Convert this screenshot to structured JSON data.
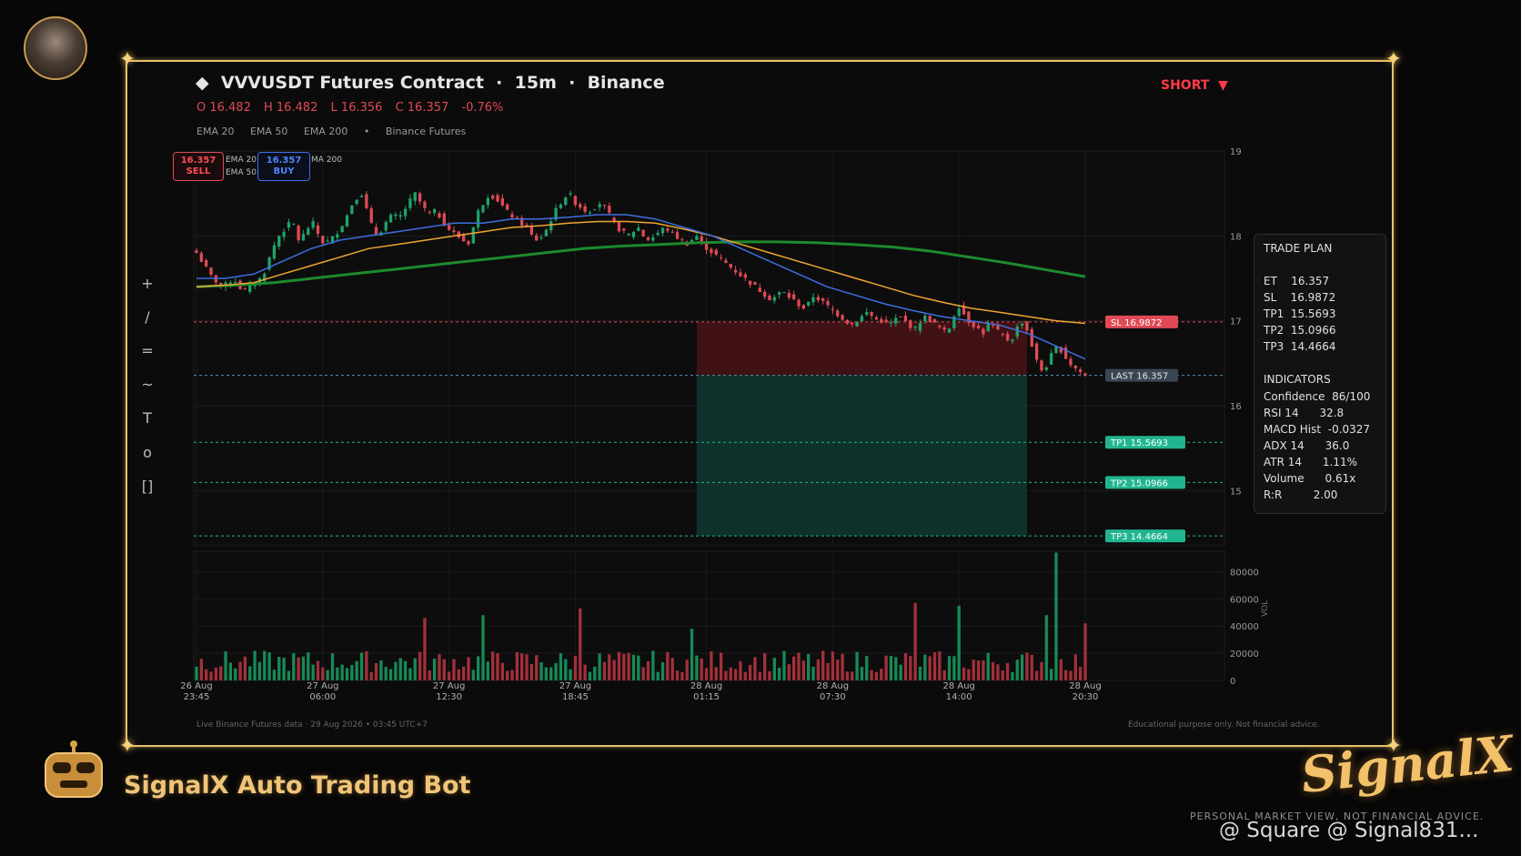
{
  "header": {
    "title": "VVVUSDT Futures Contract",
    "timeframe": "15m",
    "exchange": "Binance",
    "ohlc": {
      "open": "O 16.482",
      "high": "H 16.482",
      "low": "L 16.356",
      "close": "C 16.357",
      "change": "-0.76%"
    },
    "indicators": [
      "EMA 20",
      "EMA 50",
      "EMA 200",
      "Binance Futures"
    ],
    "direction_label": "SHORT"
  },
  "order_buttons": {
    "sell_price": "16.357",
    "sell_label": "SELL",
    "buy_price": "16.357",
    "buy_label": "BUY",
    "ema_a": "EMA 20",
    "ema_b": "EMA 50",
    "ema_c": "MA 200"
  },
  "toolbar": [
    "+",
    "/",
    "=",
    "~",
    "T",
    "o",
    "[]"
  ],
  "chart_data": {
    "type": "candlestick",
    "price_axis": {
      "ticks": [
        19,
        18,
        17,
        16,
        15
      ],
      "ylim": [
        14.35,
        19.0
      ]
    },
    "time_axis": {
      "tick_labels": [
        [
          "26 Aug",
          "23:45"
        ],
        [
          "27 Aug",
          "06:00"
        ],
        [
          "27 Aug",
          "12:30"
        ],
        [
          "27 Aug",
          "18:45"
        ],
        [
          "28 Aug",
          "01:15"
        ],
        [
          "28 Aug",
          "07:30"
        ],
        [
          "28 Aug",
          "14:00"
        ],
        [
          "28 Aug",
          "20:30"
        ]
      ]
    },
    "close_path": [
      17.8,
      17.7,
      17.6,
      17.5,
      17.45,
      17.4,
      17.45,
      17.5,
      17.4,
      17.35,
      17.4,
      17.45,
      17.5,
      17.6,
      17.8,
      17.95,
      18.05,
      18.1,
      18.2,
      17.95,
      18.0,
      18.1,
      18.15,
      18.0,
      17.9,
      17.95,
      18.0,
      18.1,
      18.2,
      18.35,
      18.45,
      18.5,
      18.3,
      18.1,
      18.0,
      18.1,
      18.2,
      18.25,
      18.2,
      18.3,
      18.4,
      18.5,
      18.4,
      18.3,
      18.25,
      18.3,
      18.2,
      18.1,
      18.05,
      18.0,
      17.95,
      17.9,
      18.1,
      18.3,
      18.4,
      18.5,
      18.45,
      18.4,
      18.3,
      18.25,
      18.2,
      18.15,
      18.1,
      18.0,
      17.95,
      18.0,
      18.1,
      18.25,
      18.35,
      18.45,
      18.5,
      18.4,
      18.35,
      18.3,
      18.3,
      18.35,
      18.4,
      18.3,
      18.2,
      18.1,
      18.05,
      18.0,
      18.05,
      18.1,
      18.0,
      17.95,
      18.0,
      18.05,
      18.1,
      18.05,
      18.0,
      17.95,
      17.9,
      17.95,
      18.0,
      17.9,
      17.85,
      17.8,
      17.75,
      17.7,
      17.65,
      17.6,
      17.55,
      17.5,
      17.45,
      17.4,
      17.35,
      17.3,
      17.25,
      17.3,
      17.35,
      17.3,
      17.25,
      17.2,
      17.15,
      17.2,
      17.3,
      17.25,
      17.2,
      17.15,
      17.1,
      17.05,
      17.0,
      16.95,
      17.0,
      17.05,
      17.1,
      17.05,
      17.0,
      17.0,
      16.95,
      17.0,
      17.05,
      17.0,
      16.95,
      16.9,
      17.0,
      17.05,
      17.0,
      16.95,
      16.9,
      16.85,
      17.0,
      17.2,
      17.1,
      17.0,
      16.95,
      16.9,
      16.85,
      17.0,
      16.9,
      16.85,
      16.8,
      16.75,
      16.9,
      17.0,
      16.9,
      16.7,
      16.5,
      16.4,
      16.5,
      16.65,
      16.7,
      16.6,
      16.5,
      16.45,
      16.4,
      16.357
    ],
    "candle_count": 184,
    "ema20_path": [
      17.5,
      17.5,
      17.55,
      17.7,
      17.85,
      17.95,
      18.0,
      18.05,
      18.1,
      18.15,
      18.15,
      18.2,
      18.2,
      18.22,
      18.25,
      18.25,
      18.2,
      18.1,
      18.0,
      17.85,
      17.7,
      17.55,
      17.4,
      17.3,
      17.2,
      17.12,
      17.05,
      17.0,
      16.95,
      16.85,
      16.7,
      16.55
    ],
    "ema50_path": [
      17.4,
      17.42,
      17.45,
      17.55,
      17.65,
      17.75,
      17.85,
      17.9,
      17.95,
      18.0,
      18.05,
      18.1,
      18.12,
      18.15,
      18.17,
      18.17,
      18.15,
      18.08,
      18.0,
      17.9,
      17.8,
      17.7,
      17.6,
      17.5,
      17.4,
      17.3,
      17.22,
      17.15,
      17.1,
      17.05,
      17.0,
      16.97
    ],
    "ema200_path": [
      17.4,
      17.42,
      17.45,
      17.5,
      17.55,
      17.6,
      17.65,
      17.7,
      17.75,
      17.8,
      17.85,
      17.88,
      17.9,
      17.92,
      17.93,
      17.93,
      17.92,
      17.9,
      17.87,
      17.82,
      17.75,
      17.68,
      17.6,
      17.52
    ],
    "levels": [
      {
        "label": "SL",
        "value": "16.9872",
        "price": 16.9872,
        "color": "#e04a55"
      },
      {
        "label": "LAST",
        "value": "16.357",
        "price": 16.357,
        "color": "#4a93b5"
      },
      {
        "label": "TP1",
        "value": "15.5693",
        "price": 15.5693,
        "color": "#21b58f"
      },
      {
        "label": "TP2",
        "value": "15.0966",
        "price": 15.0966,
        "color": "#21b58f"
      },
      {
        "label": "TP3",
        "value": "14.4664",
        "price": 14.4664,
        "color": "#21b58f"
      }
    ],
    "volume_axis": {
      "ticks": [
        80000,
        60000,
        40000,
        20000,
        0
      ],
      "label": "VOL",
      "ylim": [
        0,
        95000
      ]
    },
    "volume_spikes": [
      [
        48,
        46000
      ],
      [
        60,
        48000
      ],
      [
        80,
        53000
      ],
      [
        103,
        38000
      ],
      [
        149,
        57000
      ],
      [
        158,
        55000
      ],
      [
        176,
        48000
      ],
      [
        178,
        94000
      ],
      [
        184,
        42000
      ]
    ]
  },
  "trade_plan": {
    "title": "TRADE PLAN",
    "rows": [
      [
        "ET",
        "16.357"
      ],
      [
        "SL",
        "16.9872"
      ],
      [
        "TP1",
        "15.5693"
      ],
      [
        "TP2",
        "15.0966"
      ],
      [
        "TP3",
        "14.4664"
      ]
    ],
    "indicators_title": "INDICATORS",
    "indicators": [
      [
        "Confidence",
        "86/100"
      ],
      [
        "RSI 14",
        "32.8"
      ],
      [
        "MACD Hist",
        "-0.0327"
      ],
      [
        "ADX 14",
        "36.0"
      ],
      [
        "ATR 14",
        "1.11%"
      ],
      [
        "Volume",
        "0.61x"
      ],
      [
        "R:R",
        "2.00"
      ]
    ]
  },
  "footer": {
    "left": "Live Binance Futures data  ·  29 Aug 2026 • 03:45 UTC+7",
    "right": "Educational purpose only. Not financial advice."
  },
  "branding": {
    "bot_name": "SignalX Auto Trading Bot",
    "logo_text": "SignalX",
    "disclaimer": "PERSONAL MARKET VIEW, NOT FINANCIAL ADVICE.",
    "watermark": "@ Square @ Signal831..."
  },
  "colors": {
    "frame": "#e8c06a",
    "up": "#1fa36a",
    "down": "#e04a55",
    "ema20": "#3d6fe0",
    "ema50": "#f0a531",
    "ema200": "#1e8a2e",
    "sl_zone": "#4a1418",
    "tp_zone": "#0f3a31"
  }
}
